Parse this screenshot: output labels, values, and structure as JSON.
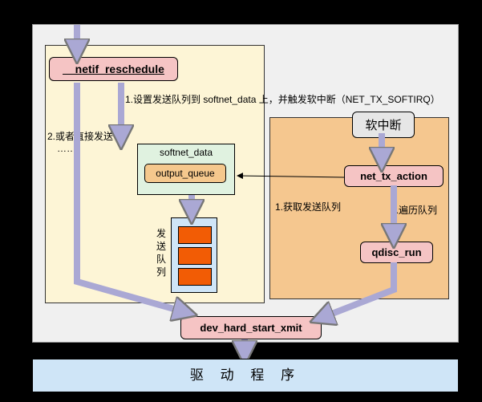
{
  "nodes": {
    "netif": "__netif_reschedule",
    "softirq_handler": "软中断",
    "net_tx_action": "net_tx_action",
    "qdisc_run": "qdisc_run",
    "dev_hard_start_xmit": "dev_hard_start_xmit",
    "softnet_data": "softnet_data",
    "output_queue": "output_queue"
  },
  "labels": {
    "l1": "1.设置发送队列到 softnet_data 上，并触发软中断（NET_TX_SOFTIRQ）",
    "l2a": "2.或者直接发送",
    "l2b": "……",
    "queue_label": "发送队列",
    "r1": "1.获取发送队列",
    "r2": "2.遍历队列"
  },
  "driver": "驱 动 程 序"
}
